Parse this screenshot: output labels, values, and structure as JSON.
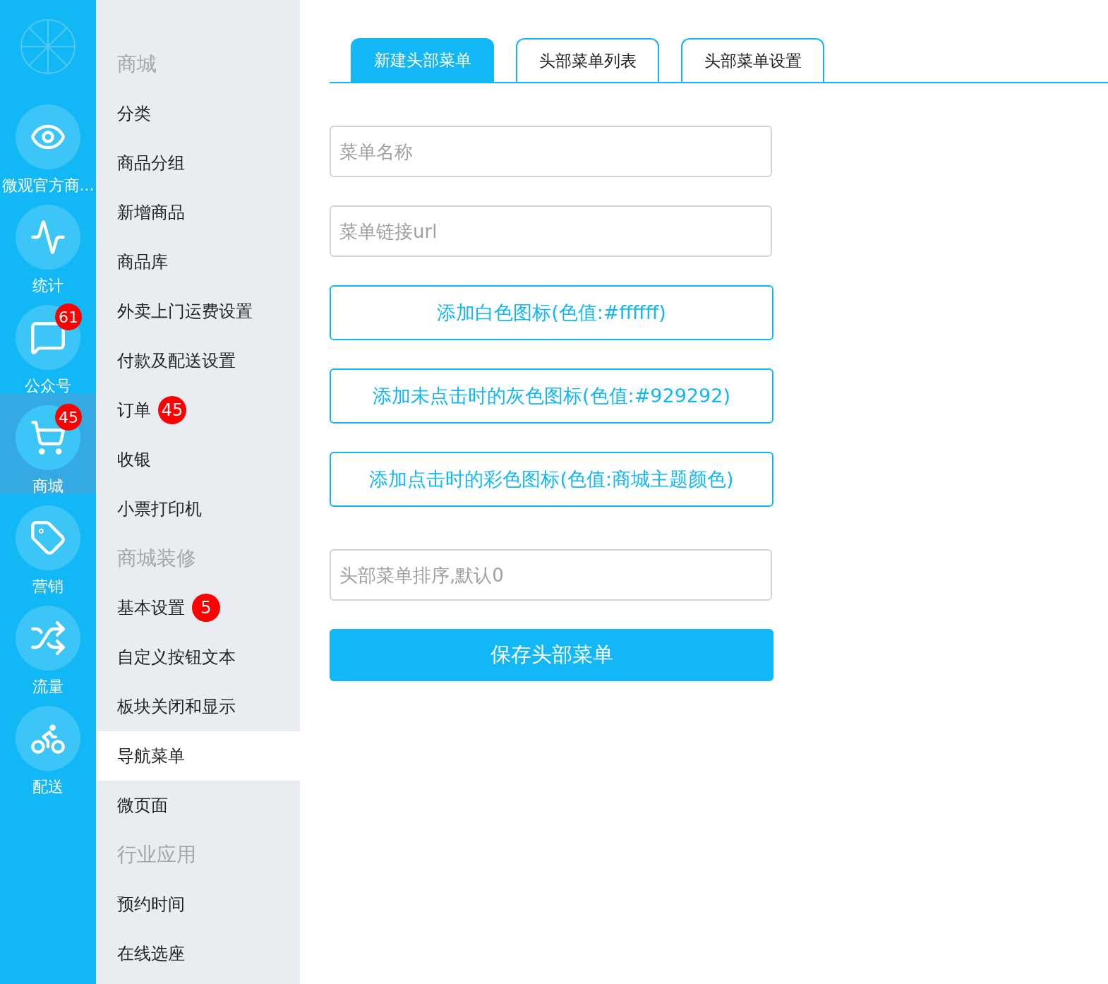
{
  "rail": [
    {
      "label": "微观官方商...",
      "selected": false
    },
    {
      "label": "统计",
      "selected": false
    },
    {
      "label": "公众号",
      "badge": "61",
      "selected": false
    },
    {
      "label": "商城",
      "badge": "45",
      "selected": true
    },
    {
      "label": "营销",
      "selected": false
    },
    {
      "label": "流量",
      "selected": false
    },
    {
      "label": "配送",
      "selected": false
    }
  ],
  "sidebar": [
    {
      "kind": "header",
      "label": "商城"
    },
    {
      "kind": "item",
      "label": "分类",
      "selected": false
    },
    {
      "kind": "item",
      "label": "商品分组",
      "selected": false
    },
    {
      "kind": "item",
      "label": "新增商品",
      "selected": false
    },
    {
      "kind": "item",
      "label": "商品库",
      "selected": false
    },
    {
      "kind": "item",
      "label": "外卖上门运费设置",
      "selected": false
    },
    {
      "kind": "item",
      "label": "付款及配送设置",
      "selected": false
    },
    {
      "kind": "item",
      "label": "订单",
      "badge": "45",
      "selected": false
    },
    {
      "kind": "item",
      "label": "收银",
      "selected": false
    },
    {
      "kind": "item",
      "label": "小票打印机",
      "selected": false
    },
    {
      "kind": "header",
      "label": "商城装修"
    },
    {
      "kind": "item",
      "label": "基本设置",
      "badge": "5",
      "selected": false
    },
    {
      "kind": "item",
      "label": "自定义按钮文本",
      "selected": false
    },
    {
      "kind": "item",
      "label": "板块关闭和显示",
      "selected": false
    },
    {
      "kind": "item",
      "label": "导航菜单",
      "selected": true
    },
    {
      "kind": "item",
      "label": "微页面",
      "selected": false
    },
    {
      "kind": "header",
      "label": "行业应用"
    },
    {
      "kind": "item",
      "label": "预约时间",
      "selected": false
    },
    {
      "kind": "item",
      "label": "在线选座",
      "selected": false
    }
  ],
  "tabs": [
    {
      "label": "新建头部菜单",
      "selected": true
    },
    {
      "label": "头部菜单列表",
      "selected": false
    },
    {
      "label": "头部菜单设置",
      "selected": false
    }
  ],
  "form": [
    {
      "kind": "input",
      "placeholder": "菜单名称"
    },
    {
      "kind": "input",
      "placeholder": "菜单链接url"
    },
    {
      "kind": "upload",
      "label": "添加白色图标(色值:#ffffff)"
    },
    {
      "kind": "upload",
      "label": "添加未点击时的灰色图标(色值:#929292)"
    },
    {
      "kind": "upload",
      "label": "添加点击时的彩色图标(色值:商城主题颜色)"
    },
    {
      "kind": "input",
      "placeholder": "头部菜单排序,默认0"
    }
  ],
  "save_button": "保存头部菜单"
}
